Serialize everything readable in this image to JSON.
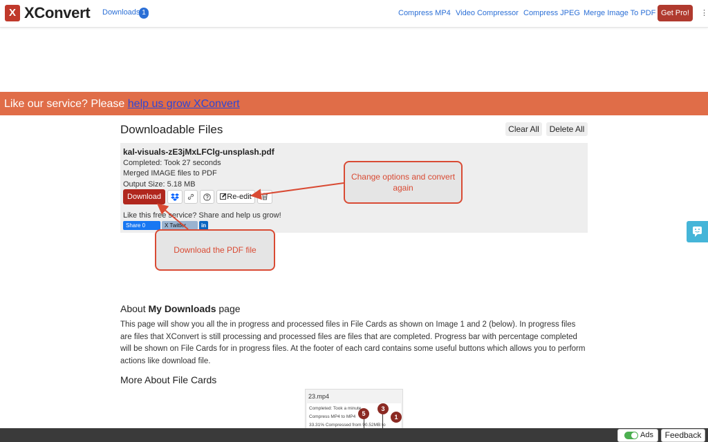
{
  "navbar": {
    "logo_letter": "X",
    "brand": "XConvert",
    "downloads_label": "Downloads",
    "downloads_count": "1",
    "links": [
      "Compress MP4",
      "Video Compressor",
      "Compress JPEG",
      "Merge Image To PDF"
    ],
    "get_pro": "Get Pro!",
    "menu": "⋮"
  },
  "banner": {
    "text": "Like our service? Please ",
    "link": "help us grow XConvert",
    "color": "#e06d48"
  },
  "downloads": {
    "title": "Downloadable Files",
    "clear_all": "Clear All",
    "delete_all": "Delete All"
  },
  "file_card": {
    "filename": "kal-visuals-zE3jMxLFClg-unsplash.pdf",
    "completed": "Completed: Took 27 seconds",
    "action": "Merged IMAGE files to PDF",
    "output_size": "Output Size: 5.18 MB",
    "download_label": "Download",
    "reedit_label": "Re-edit",
    "share_text": "Like this free service? Share and help us grow!",
    "facebook_label": "Share 0",
    "twitter_label": "X Twitter",
    "linkedin_label": "in"
  },
  "callouts": {
    "reedit_note": "Change options and convert again",
    "download_note": "Download the PDF file"
  },
  "about": {
    "title_prefix": "About ",
    "title_bold": "My Downloads",
    "title_suffix": " page",
    "paragraph": "This page will show you all the in progress and processed files in File Cards as shown on Image 1 and 2 (below). In progress files are files that XConvert is still processing and processed files are files that are completed. Progress bar with percentage completed will be shown on File Cards for in progress files. At the footer of each card contains some useful buttons which allows you to perform actions like download file.",
    "more_title": "More About File Cards"
  },
  "thumbnail": {
    "filename": "23.mp4",
    "line1": "Completed: Took a minute",
    "line2": "Compress MP4 to MP4",
    "line3": "33.31% Compressed from 90.52MB to",
    "badges": [
      "5",
      "3",
      "1"
    ]
  },
  "footer": {
    "ads_label": "Ads",
    "feedback_label": "Feedback"
  },
  "colors": {
    "brand_red": "#c0392b",
    "link_blue": "#2b6fd6",
    "callout_red": "#d94a33"
  }
}
